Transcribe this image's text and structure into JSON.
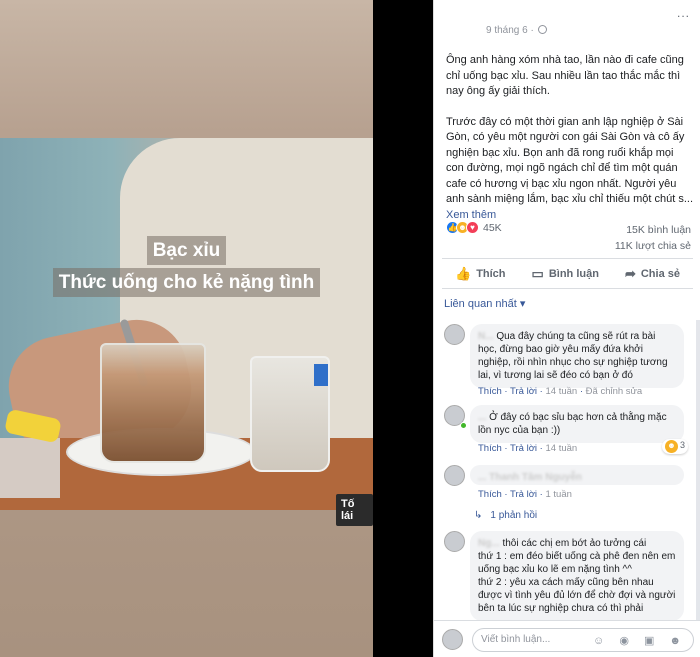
{
  "media": {
    "caption_line1": "Bạc xỉu",
    "caption_line2": "Thức uống cho kẻ nặng tình",
    "badge": "Tố lái"
  },
  "post": {
    "date": "9 tháng 6 ·",
    "more_menu": "...",
    "paragraph1": "Ông anh hàng xóm nhà tao, lần nào đi cafe cũng chỉ uống bạc xỉu. Sau nhiều lần tao thắc mắc thì nay ông ấy giải thích.",
    "paragraph2": "Trước đây có một thời gian anh lập nghiệp ở Sài Gòn, có yêu một người con gái Sài Gòn và cô ấy nghiện bạc xỉu. Bọn anh đã rong ruổi khắp mọi con đường, mọi ngõ ngách chỉ để tìm một quán cafe có hương vị bạc xỉu ngon nhất. Người yêu anh sành miệng lắm, bạc xỉu chỉ thiếu một chút s...",
    "see_more": "Xem thêm"
  },
  "reactions": {
    "count": "45K",
    "comments": "15K bình luận",
    "shares": "11K lượt chia sẻ"
  },
  "actions": {
    "like": "Thích",
    "comment": "Bình luận",
    "share": "Chia sẻ"
  },
  "sort": {
    "label": "Liên quan nhất ▾"
  },
  "comments": [
    {
      "name": "N...",
      "text": "Qua đây chúng ta cũng sẽ rút ra bài học, đừng bao giờ yêu mấy đứa khởi nghiệp, rồi nhìn nhục cho sự nghiệp tương lai, vì tương lai sẽ đéo có bạn ở đó",
      "like": "Thích",
      "reply": "Trả lời",
      "time": "14 tuần",
      "edited": "Đã chỉnh sửa"
    },
    {
      "name": "...",
      "text": "Ở đây có bạc sỉu bạc hơn cả thằng mặc lồn nyc của bạn :))",
      "like": "Thích",
      "reply": "Trả lời",
      "time": "14 tuần",
      "reaction_count": "3"
    },
    {
      "name": "... Thanh Tâm Nguyễn",
      "text": "",
      "like": "Thích",
      "reply": "Trả lời",
      "time": "1 tuần",
      "replies_link": "1 phản hồi"
    },
    {
      "name": "Ng...",
      "text": "thôi các chị em bớt ảo tưởng cái\nthứ 1 : em đéo biết uống cà phê đen nên em uống bạc xỉu ko lẽ em nặng tình ^^\nthứ 2 : yêu xa cách mấy cũng bên nhau được vì tình yêu đủ lớn để chờ đợi và người bên ta lúc sự nghiệp chưa có thì phải"
    }
  ],
  "composer": {
    "placeholder": "Viết bình luận...",
    "icons": "☺ ◉ ▣ ☻"
  }
}
